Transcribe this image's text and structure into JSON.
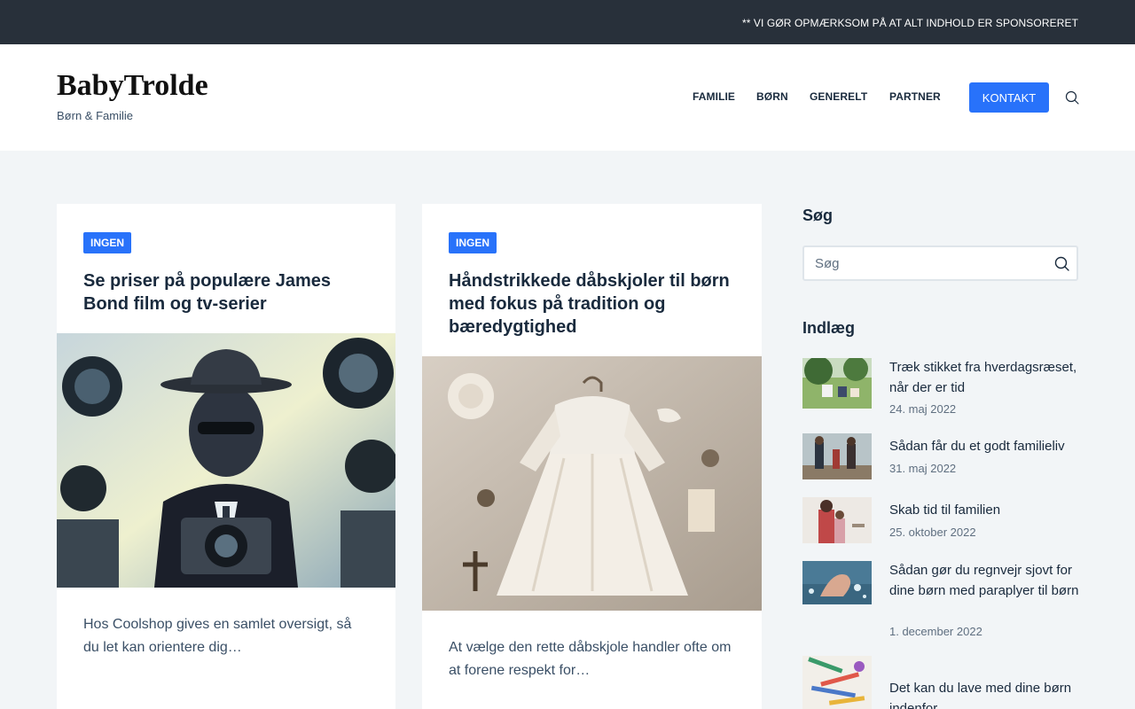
{
  "topbar": {
    "notice": "** VI GØR OPMÆRKSOM PÅ AT ALT INDHOLD ER SPONSORERET"
  },
  "header": {
    "site_title": "BabyTrolde",
    "tagline": "Børn & Familie",
    "nav": [
      "FAMILIE",
      "BØRN",
      "GENERELT",
      "PARTNER"
    ],
    "contact_label": "KONTAKT",
    "search_icon": "search-icon"
  },
  "posts": [
    {
      "badge": "INGEN",
      "title": "Se priser på populære James Bond film og tv-serier",
      "excerpt": "Hos Coolshop gives en samlet oversigt, så du let kan orientere dig…"
    },
    {
      "badge": "INGEN",
      "title": "Håndstrikkede dåbskjoler til børn med fokus på tradition og bæredygtighed",
      "excerpt": "At vælge den rette dåbskjole handler ofte om at forene respekt for…"
    }
  ],
  "sidebar": {
    "search_title": "Søg",
    "search_placeholder": "Søg",
    "posts_title": "Indlæg",
    "recent_posts": [
      {
        "title": "Træk stikket fra hverdagsræset, når der er tid",
        "date": "24. maj 2022"
      },
      {
        "title": "Sådan får du et godt familieliv",
        "date": "31. maj 2022"
      },
      {
        "title": "Skab tid til familien",
        "date": "25. oktober 2022"
      },
      {
        "title": "Sådan gør du regnvejr sjovt for dine børn med paraplyer til børn",
        "date": "1. december 2022"
      },
      {
        "title": "Det kan du lave med dine børn indenfor",
        "date": ""
      }
    ]
  },
  "colors": {
    "accent": "#2872fa",
    "topbar": "#28303a",
    "heading": "#192a3d",
    "text": "#3a4f66",
    "background": "#f2f5f7"
  }
}
